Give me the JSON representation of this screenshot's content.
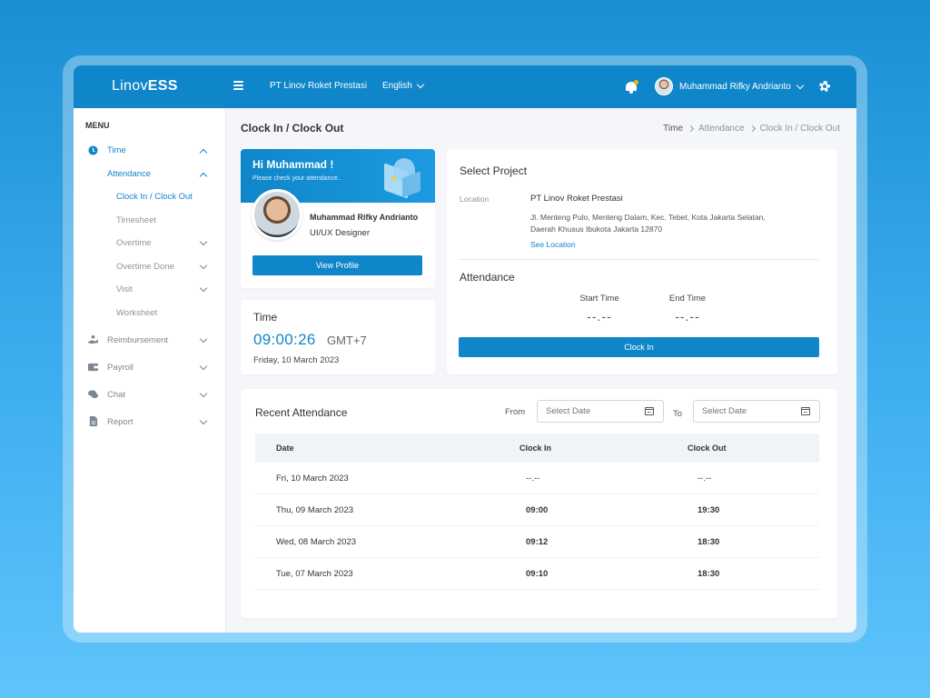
{
  "app": {
    "logo_light": "Linov",
    "logo_bold": "ESS",
    "company": "PT Linov Roket Prestasi",
    "language": "English",
    "user_name": "Muhammad Rifky Andrianto",
    "accent": "#0f86c9"
  },
  "sidebar": {
    "title": "MENU",
    "time_label": "Time",
    "attendance_label": "Attendance",
    "sub_items": [
      "Clock In / Clock Out",
      "Timesheet",
      "Overtime",
      "Overtime Done",
      "Visit",
      "Worksheet"
    ],
    "items": [
      {
        "label": "Reimbursement",
        "icon": "hand-money-icon"
      },
      {
        "label": "Payroll",
        "icon": "wallet-icon"
      },
      {
        "label": "Chat",
        "icon": "chat-icon"
      },
      {
        "label": "Report",
        "icon": "document-icon"
      }
    ]
  },
  "header": {
    "title": "Clock In / Clock Out",
    "breadcrumb": [
      "Time",
      "Attendance",
      "Clock In / Clock Out"
    ]
  },
  "profile": {
    "greeting": "Hi Muhammad !",
    "subtitle": "Please check your attendance..",
    "name": "Muhammad Rifky Andrianto",
    "role": "UI/UX Designer",
    "button": "View Profile"
  },
  "time_card": {
    "title": "Time",
    "clock": "09:00:26",
    "timezone": "GMT+7",
    "date": "Friday, 10 March 2023"
  },
  "project": {
    "title": "Select Project",
    "location_label": "Location",
    "location_name": "PT Linov Roket Prestasi",
    "address": "Jl. Menteng Pulo, Menteng Dalam, Kec. Tebet, Kota Jakarta Selatan, Daerah Khusus Ibukota Jakarta 12870",
    "see_location": "See Location",
    "attendance_title": "Attendance",
    "start_time_label": "Start Time",
    "start_time_value": "--.--",
    "end_time_label": "End Time",
    "end_time_value": "--.--",
    "clock_in_button": "Clock In"
  },
  "recent": {
    "title": "Recent Attendance",
    "from_label": "From",
    "to_label": "To",
    "from_placeholder": "Select Date",
    "to_placeholder": "Select Date",
    "columns": [
      "Date",
      "Clock In",
      "Clock Out"
    ],
    "rows": [
      {
        "date": "Fri, 10 March 2023",
        "in": "--.--",
        "out": "--.--"
      },
      {
        "date": "Thu, 09 March 2023",
        "in": "09:00",
        "out": "19:30"
      },
      {
        "date": "Wed, 08 March 2023",
        "in": "09:12",
        "out": "18:30"
      },
      {
        "date": "Tue, 07 March 2023",
        "in": "09:10",
        "out": "18:30"
      }
    ]
  }
}
